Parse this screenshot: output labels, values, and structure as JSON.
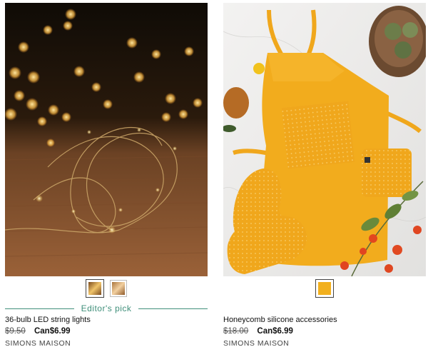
{
  "products": [
    {
      "image_alt": "36-bulb LED string lights photo",
      "badge": "Editor's pick",
      "name": "36-bulb LED string lights",
      "old_price": "$9.50",
      "new_price": "Can$6.99",
      "brand": "SIMONS MAISON",
      "swatch_colors": [
        "#c89a4a",
        "#d6a77a"
      ]
    },
    {
      "image_alt": "Honeycomb silicone accessories photo",
      "badge": "",
      "name": "Honeycomb silicone accessories",
      "old_price": "$18.00",
      "new_price": "Can$6.99",
      "brand": "SIMONS MAISON",
      "swatch_colors": [
        "#f2b01e"
      ]
    }
  ]
}
